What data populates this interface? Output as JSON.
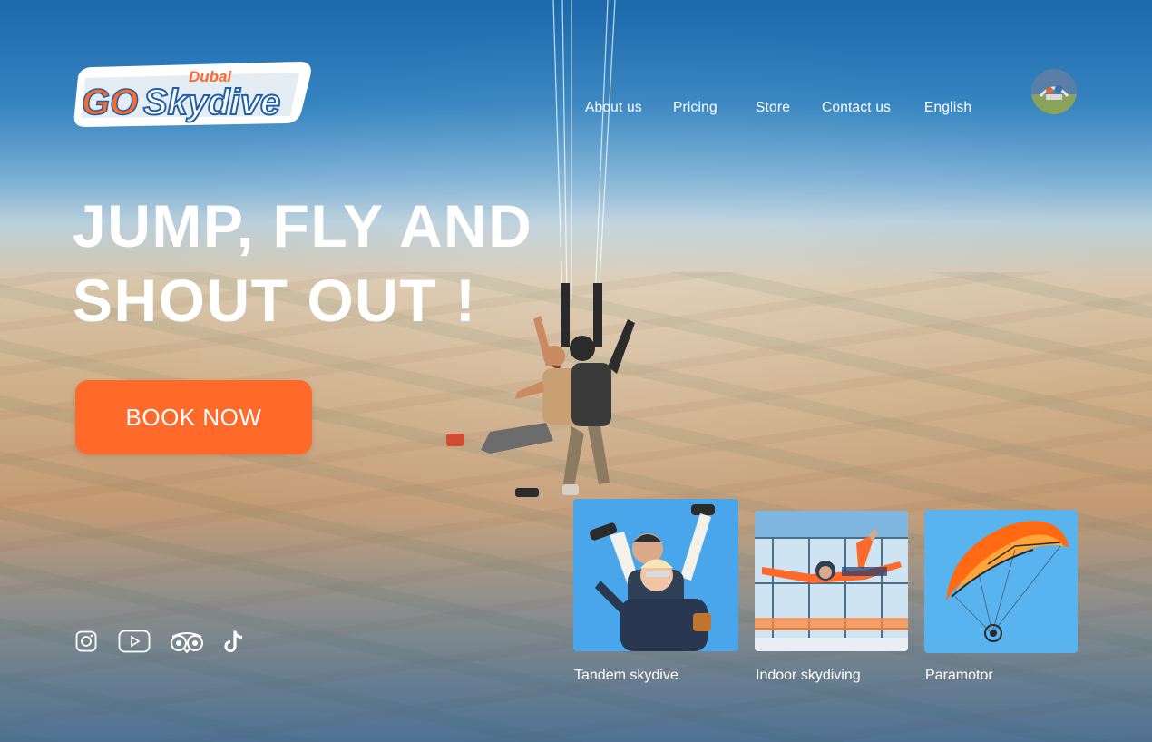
{
  "brand": {
    "logo_top": "Dubai",
    "logo_go": "GO",
    "logo_main": "Skydive",
    "logo_colors": {
      "orange": "#ff6a2b",
      "white": "#ffffff",
      "blue": "#1f5fa8"
    }
  },
  "nav": {
    "items": [
      {
        "label": "About us"
      },
      {
        "label": "Pricing"
      },
      {
        "label": "Store"
      },
      {
        "label": "Contact us"
      },
      {
        "label": "English"
      }
    ],
    "avatar_icon": "user-avatar-photo"
  },
  "hero": {
    "line1": "JUMP, FLY AND",
    "line2": "SHOUT OUT !"
  },
  "cta": {
    "book_label": "BOOK NOW",
    "color": "#ff6a2b"
  },
  "social": [
    {
      "name": "instagram-icon"
    },
    {
      "name": "youtube-icon"
    },
    {
      "name": "tripadvisor-icon"
    },
    {
      "name": "tiktok-icon"
    }
  ],
  "cards": [
    {
      "label": "Tandem skydive",
      "icon": "tandem-skydive-photo"
    },
    {
      "label": "Indoor skydiving",
      "icon": "indoor-skydiving-photo"
    },
    {
      "label": "Paramotor",
      "icon": "paramotor-photo"
    }
  ]
}
